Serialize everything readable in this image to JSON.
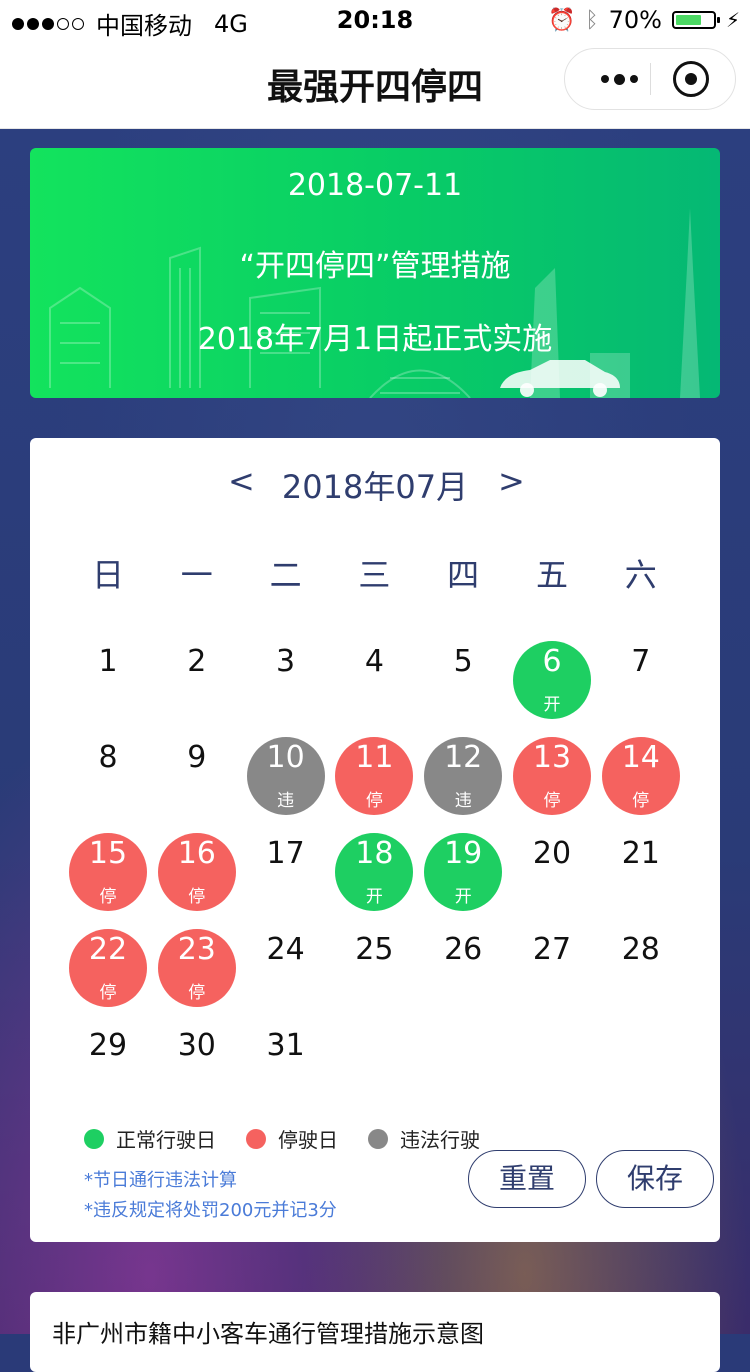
{
  "status_bar": {
    "carrier": "中国移动",
    "network": "4G",
    "time": "20:18",
    "battery": "70%",
    "battery_level": 0.7,
    "battery_color": "#4cd964"
  },
  "nav": {
    "title": "最强开四停四",
    "more_icon": "more-dots-icon",
    "close_icon": "target-close-icon"
  },
  "banner": {
    "date": "2018-07-11",
    "headline": "“开四停四”管理措施",
    "subline": "2018年7月1日起正式实施"
  },
  "calendar": {
    "prev_label": "<",
    "next_label": ">",
    "month_label": "2018年07月",
    "weekdays": [
      "日",
      "一",
      "二",
      "三",
      "四",
      "五",
      "六"
    ],
    "first_weekday_index": 0,
    "days": [
      {
        "n": "1"
      },
      {
        "n": "2"
      },
      {
        "n": "3"
      },
      {
        "n": "4"
      },
      {
        "n": "5"
      },
      {
        "n": "6",
        "status": "open",
        "label": "开"
      },
      {
        "n": "7"
      },
      {
        "n": "8"
      },
      {
        "n": "9"
      },
      {
        "n": "10",
        "status": "illegal",
        "label": "违"
      },
      {
        "n": "11",
        "status": "stop",
        "label": "停"
      },
      {
        "n": "12",
        "status": "illegal",
        "label": "违"
      },
      {
        "n": "13",
        "status": "stop",
        "label": "停"
      },
      {
        "n": "14",
        "status": "stop",
        "label": "停"
      },
      {
        "n": "15",
        "status": "stop",
        "label": "停"
      },
      {
        "n": "16",
        "status": "stop",
        "label": "停"
      },
      {
        "n": "17"
      },
      {
        "n": "18",
        "status": "open",
        "label": "开"
      },
      {
        "n": "19",
        "status": "open",
        "label": "开"
      },
      {
        "n": "20"
      },
      {
        "n": "21"
      },
      {
        "n": "22",
        "status": "stop",
        "label": "停"
      },
      {
        "n": "23",
        "status": "stop",
        "label": "停"
      },
      {
        "n": "24"
      },
      {
        "n": "25"
      },
      {
        "n": "26"
      },
      {
        "n": "27"
      },
      {
        "n": "28"
      },
      {
        "n": "29"
      },
      {
        "n": "30"
      },
      {
        "n": "31"
      }
    ],
    "colors": {
      "open": "#1ecf62",
      "stop": "#f5625f",
      "illegal": "#888888"
    },
    "legend": [
      {
        "label": "正常行驶日",
        "color": "#1ecf62"
      },
      {
        "label": "停驶日",
        "color": "#f5625f"
      },
      {
        "label": "违法行驶",
        "color": "#888888"
      }
    ],
    "notes": [
      "*节日通行违法计算",
      "*违反规定将处罚200元并记3分"
    ],
    "reset_label": "重置",
    "save_label": "保存"
  },
  "bottom_card": {
    "title": "非广州市籍中小客车通行管理措施示意图"
  }
}
